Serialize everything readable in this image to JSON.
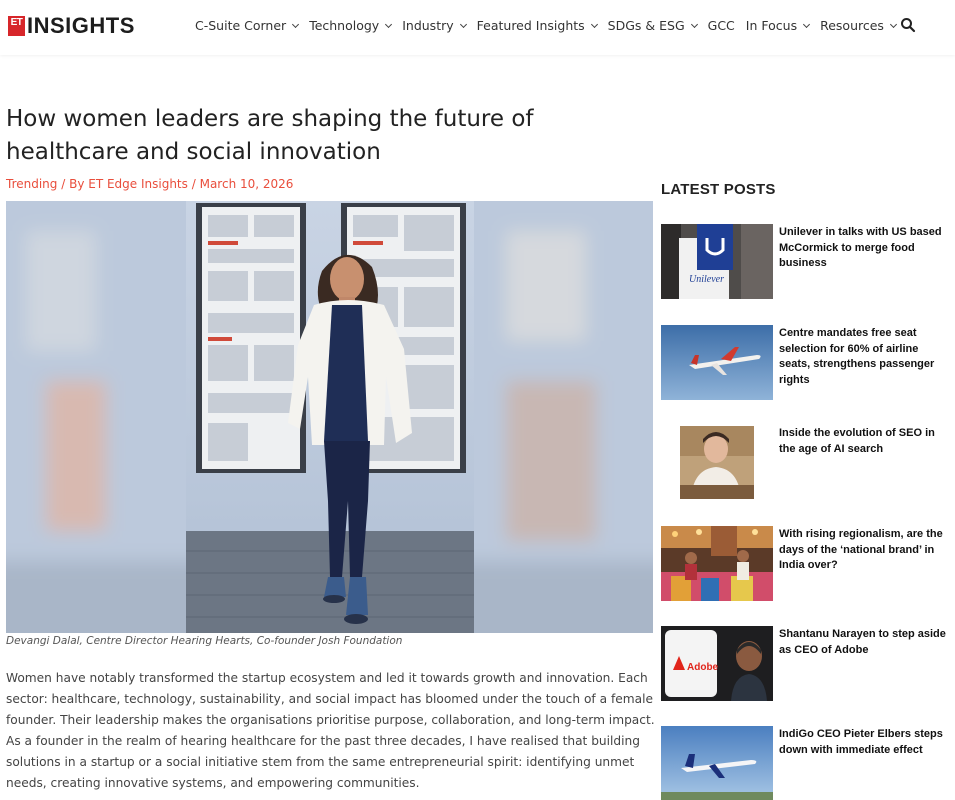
{
  "brand": {
    "logo_mark": "ET",
    "logo_text": "INSIGHTS"
  },
  "nav": {
    "items": [
      {
        "label": "C-Suite Corner",
        "dropdown": true
      },
      {
        "label": "Technology",
        "dropdown": true
      },
      {
        "label": "Industry",
        "dropdown": true
      },
      {
        "label": "Featured Insights",
        "dropdown": true
      },
      {
        "label": "SDGs & ESG",
        "dropdown": true
      },
      {
        "label": "GCC",
        "dropdown": false
      },
      {
        "label": "In Focus",
        "dropdown": true
      },
      {
        "label": "Resources",
        "dropdown": true
      }
    ],
    "search_icon": "search-icon"
  },
  "article": {
    "title": "How women leaders are shaping the future of healthcare and social innovation",
    "category": "Trending",
    "author": "By ET Edge Insights",
    "date": "March 10, 2026",
    "caption": "Devangi Dalal, Centre Director Hearing Hearts, Co-founder Josh Foundation",
    "body": "Women have notably transformed the startup ecosystem and led it towards growth and innovation. Each sector: healthcare, technology, sustainability, and social impact has bloomed under the touch of a female founder. Their leadership makes the organisations prioritise purpose, collaboration, and long-term impact. As a founder in the realm of hearing healthcare for the past three decades, I have realised that building solutions in a startup or a social initiative stem from the same entrepreneurial spirit: identifying unmet needs, creating innovative systems, and empowering communities."
  },
  "sidebar": {
    "heading": "LATEST POSTS",
    "posts": [
      {
        "title": "Unilever in talks with US based McCormick to merge food business"
      },
      {
        "title": "Centre mandates free seat selection for 60% of airline seats, strengthens passenger rights"
      },
      {
        "title": "Inside the evolution of SEO in the age of AI search"
      },
      {
        "title": "With rising regionalism, are the days of the ‘national brand’ in India over?"
      },
      {
        "title": "Shantanu Narayen to step aside as CEO of Adobe"
      },
      {
        "title": "IndiGo CEO Pieter Elbers steps down with immediate effect"
      }
    ]
  },
  "thumb_text": {
    "unilever_sign": "Unilever",
    "adobe_wordmark": "Adobe"
  },
  "colors": {
    "accent": "#e94e3c",
    "brand_red": "#d7262a"
  }
}
